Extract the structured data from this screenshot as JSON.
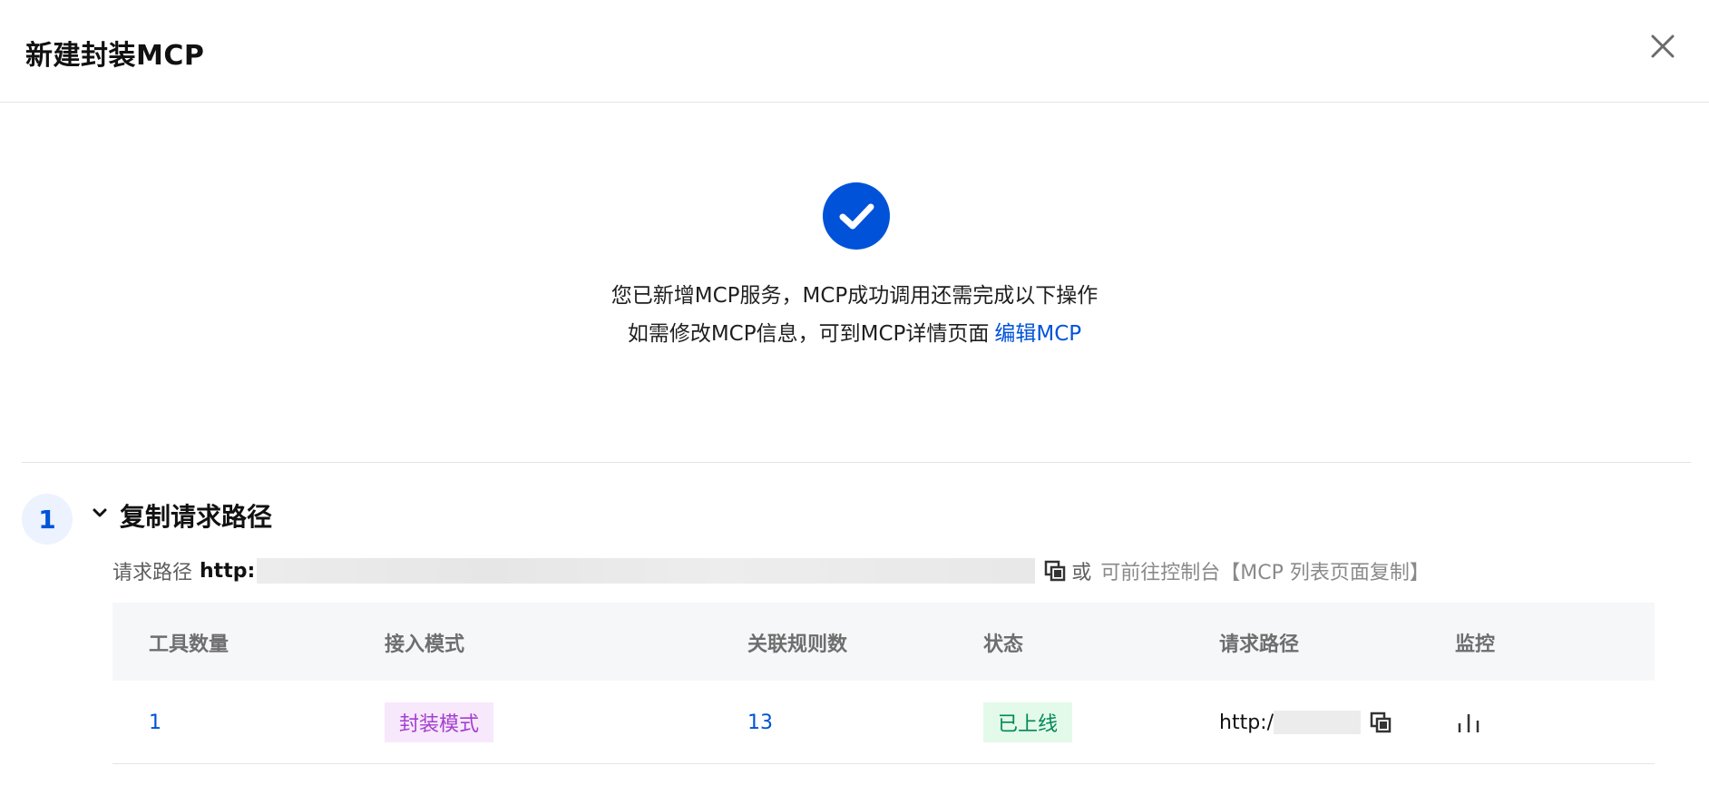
{
  "dialog": {
    "title": "新建封装MCP"
  },
  "success": {
    "message": "您已新增MCP服务，MCP成功调用还需完成以下操作",
    "edit_hint": "如需修改MCP信息，可到MCP详情页面",
    "edit_link": "编辑MCP"
  },
  "step": {
    "number": "1",
    "title": "复制请求路径",
    "path_label": "请求路径",
    "path_value": "http:",
    "or_text": "或",
    "console_hint": "可前往控制台【MCP 列表页面复制】"
  },
  "table": {
    "headers": [
      "工具数量",
      "接入模式",
      "关联规则数",
      "状态",
      "请求路径",
      "监控"
    ],
    "row": {
      "tool_count": "1",
      "mode": "封装模式",
      "rule_count": "13",
      "status": "已上线",
      "url": "http:/"
    }
  },
  "colors": {
    "primary": "#0052d9",
    "mode_tag_bg": "#f8e8fc",
    "mode_tag_text": "#a33fd0",
    "status_tag_bg": "#e3f9e9",
    "status_tag_text": "#008858"
  },
  "icons": {
    "close": "close-icon",
    "success": "check-circle-icon",
    "collapse": "chevron-down-icon",
    "copy": "copy-icon",
    "monitor": "bar-chart-icon"
  }
}
